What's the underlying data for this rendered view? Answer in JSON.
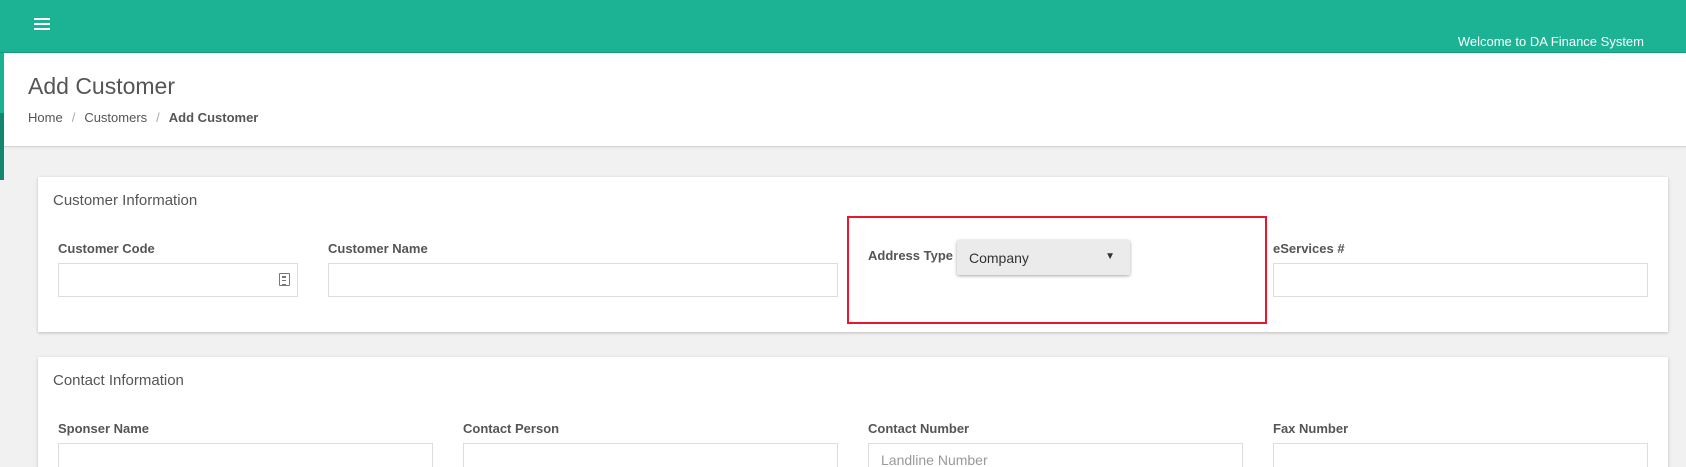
{
  "header": {
    "welcome": "Welcome to DA Finance System",
    "menu_icon": "hamburger-icon"
  },
  "page": {
    "title": "Add Customer",
    "breadcrumb": [
      "Home",
      "Customers",
      "Add Customer"
    ],
    "breadcrumb_separator": "/"
  },
  "customer_info": {
    "title": "Customer Information",
    "customer_code": {
      "label": "Customer Code",
      "value": "",
      "icon": "id-card-icon"
    },
    "customer_name": {
      "label": "Customer Name",
      "value": ""
    },
    "address_type": {
      "label": "Address Type",
      "selected": "Company",
      "caret": "▼"
    },
    "eservices": {
      "label": "eServices #",
      "value": ""
    }
  },
  "contact_info": {
    "title": "Contact Information",
    "sponser_name": {
      "label": "Sponser Name",
      "value": ""
    },
    "contact_person": {
      "label": "Contact Person",
      "value": ""
    },
    "contact_number": {
      "label": "Contact Number",
      "placeholder": "Landline Number",
      "value": ""
    },
    "fax_number": {
      "label": "Fax Number",
      "value": ""
    }
  },
  "colors": {
    "brand": "#1bb394",
    "highlight": "#e8172d"
  }
}
